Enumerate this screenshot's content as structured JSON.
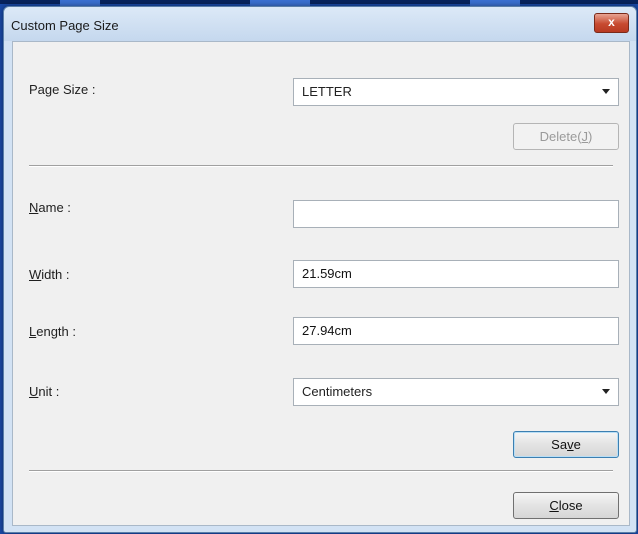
{
  "dialog": {
    "title": "Custom Page Size",
    "close_glyph": "x"
  },
  "page_size": {
    "label": "Page Size :",
    "value": "LETTER",
    "delete_label_pre": "Delete(",
    "delete_label_key": "J",
    "delete_label_post": ")"
  },
  "name": {
    "label_key": "N",
    "label_rest": "ame :",
    "value": ""
  },
  "width": {
    "label_key": "W",
    "label_rest": "idth :",
    "value": "21.59cm"
  },
  "length": {
    "label_key": "L",
    "label_rest": "ength :",
    "value": "27.94cm"
  },
  "unit": {
    "label_key": "U",
    "label_rest": "nit :",
    "value": "Centimeters"
  },
  "buttons": {
    "save_pre": "Sa",
    "save_key": "v",
    "save_post": "e",
    "close_key": "C",
    "close_rest": "lose"
  },
  "colors": {
    "title_bar": "#c5d8ee",
    "close_button": "#c74a30",
    "client_bg": "#f0f0f0"
  },
  "icons": {
    "close": "close-icon",
    "dropdown": "chevron-down-icon"
  }
}
